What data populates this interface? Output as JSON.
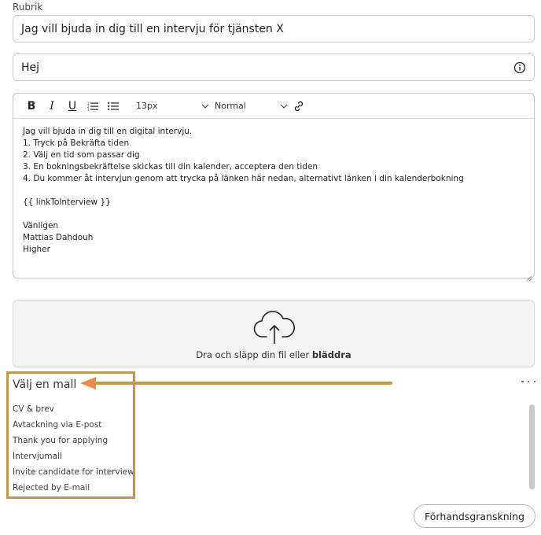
{
  "form": {
    "subject_label": "Rubrik",
    "subject_value": "Jag vill bjuda in dig till en intervju för tjänsten X",
    "greeting_value": "Hej"
  },
  "toolbar": {
    "bold": "B",
    "italic": "I",
    "underline": "U",
    "font_size": "13px",
    "header_style": "Normal"
  },
  "editor": {
    "lines": [
      "Jag vill bjuda in dig till en digital intervju.",
      "1. Tryck på Bekräfta tiden",
      "2. Välj en tid som passar dig",
      "3. En bokningsbekräftelse skickas till din kalender, acceptera den tiden",
      "4. Du kommer åt intervjun genom att trycka på länken här nedan, alternativt länken i din kalenderbokning",
      "",
      "{{ linkToInterview }}",
      "",
      "Vänligen",
      "Mattias Dahdouh",
      "Higher"
    ]
  },
  "upload": {
    "text": "Dra och släpp din fil eller ",
    "browse": "bläddra"
  },
  "templates": {
    "title": "Välj en mall",
    "items": [
      "CV & brev",
      "Avtackning via E-post",
      "Thank you for applying",
      "Intervjumall",
      "Invite candidate for interview",
      "Rejected by E-mail"
    ]
  },
  "actions": {
    "preview": "Förhandsgranskning"
  },
  "colors": {
    "highlight": "#c19a47",
    "arrow": "#e88d4f"
  }
}
